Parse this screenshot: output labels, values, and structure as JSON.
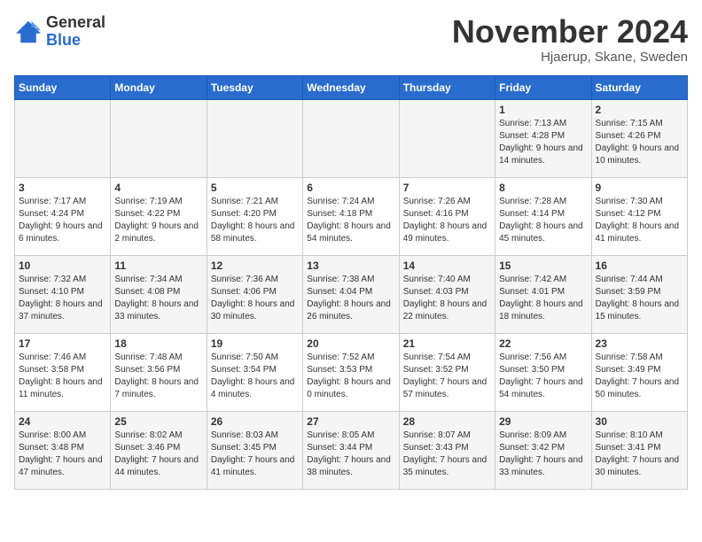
{
  "header": {
    "logo_general": "General",
    "logo_blue": "Blue",
    "month_title": "November 2024",
    "location": "Hjaerup, Skane, Sweden"
  },
  "weekdays": [
    "Sunday",
    "Monday",
    "Tuesday",
    "Wednesday",
    "Thursday",
    "Friday",
    "Saturday"
  ],
  "weeks": [
    [
      {
        "day": "",
        "info": ""
      },
      {
        "day": "",
        "info": ""
      },
      {
        "day": "",
        "info": ""
      },
      {
        "day": "",
        "info": ""
      },
      {
        "day": "",
        "info": ""
      },
      {
        "day": "1",
        "info": "Sunrise: 7:13 AM\nSunset: 4:28 PM\nDaylight: 9 hours and 14 minutes."
      },
      {
        "day": "2",
        "info": "Sunrise: 7:15 AM\nSunset: 4:26 PM\nDaylight: 9 hours and 10 minutes."
      }
    ],
    [
      {
        "day": "3",
        "info": "Sunrise: 7:17 AM\nSunset: 4:24 PM\nDaylight: 9 hours and 6 minutes."
      },
      {
        "day": "4",
        "info": "Sunrise: 7:19 AM\nSunset: 4:22 PM\nDaylight: 9 hours and 2 minutes."
      },
      {
        "day": "5",
        "info": "Sunrise: 7:21 AM\nSunset: 4:20 PM\nDaylight: 8 hours and 58 minutes."
      },
      {
        "day": "6",
        "info": "Sunrise: 7:24 AM\nSunset: 4:18 PM\nDaylight: 8 hours and 54 minutes."
      },
      {
        "day": "7",
        "info": "Sunrise: 7:26 AM\nSunset: 4:16 PM\nDaylight: 8 hours and 49 minutes."
      },
      {
        "day": "8",
        "info": "Sunrise: 7:28 AM\nSunset: 4:14 PM\nDaylight: 8 hours and 45 minutes."
      },
      {
        "day": "9",
        "info": "Sunrise: 7:30 AM\nSunset: 4:12 PM\nDaylight: 8 hours and 41 minutes."
      }
    ],
    [
      {
        "day": "10",
        "info": "Sunrise: 7:32 AM\nSunset: 4:10 PM\nDaylight: 8 hours and 37 minutes."
      },
      {
        "day": "11",
        "info": "Sunrise: 7:34 AM\nSunset: 4:08 PM\nDaylight: 8 hours and 33 minutes."
      },
      {
        "day": "12",
        "info": "Sunrise: 7:36 AM\nSunset: 4:06 PM\nDaylight: 8 hours and 30 minutes."
      },
      {
        "day": "13",
        "info": "Sunrise: 7:38 AM\nSunset: 4:04 PM\nDaylight: 8 hours and 26 minutes."
      },
      {
        "day": "14",
        "info": "Sunrise: 7:40 AM\nSunset: 4:03 PM\nDaylight: 8 hours and 22 minutes."
      },
      {
        "day": "15",
        "info": "Sunrise: 7:42 AM\nSunset: 4:01 PM\nDaylight: 8 hours and 18 minutes."
      },
      {
        "day": "16",
        "info": "Sunrise: 7:44 AM\nSunset: 3:59 PM\nDaylight: 8 hours and 15 minutes."
      }
    ],
    [
      {
        "day": "17",
        "info": "Sunrise: 7:46 AM\nSunset: 3:58 PM\nDaylight: 8 hours and 11 minutes."
      },
      {
        "day": "18",
        "info": "Sunrise: 7:48 AM\nSunset: 3:56 PM\nDaylight: 8 hours and 7 minutes."
      },
      {
        "day": "19",
        "info": "Sunrise: 7:50 AM\nSunset: 3:54 PM\nDaylight: 8 hours and 4 minutes."
      },
      {
        "day": "20",
        "info": "Sunrise: 7:52 AM\nSunset: 3:53 PM\nDaylight: 8 hours and 0 minutes."
      },
      {
        "day": "21",
        "info": "Sunrise: 7:54 AM\nSunset: 3:52 PM\nDaylight: 7 hours and 57 minutes."
      },
      {
        "day": "22",
        "info": "Sunrise: 7:56 AM\nSunset: 3:50 PM\nDaylight: 7 hours and 54 minutes."
      },
      {
        "day": "23",
        "info": "Sunrise: 7:58 AM\nSunset: 3:49 PM\nDaylight: 7 hours and 50 minutes."
      }
    ],
    [
      {
        "day": "24",
        "info": "Sunrise: 8:00 AM\nSunset: 3:48 PM\nDaylight: 7 hours and 47 minutes."
      },
      {
        "day": "25",
        "info": "Sunrise: 8:02 AM\nSunset: 3:46 PM\nDaylight: 7 hours and 44 minutes."
      },
      {
        "day": "26",
        "info": "Sunrise: 8:03 AM\nSunset: 3:45 PM\nDaylight: 7 hours and 41 minutes."
      },
      {
        "day": "27",
        "info": "Sunrise: 8:05 AM\nSunset: 3:44 PM\nDaylight: 7 hours and 38 minutes."
      },
      {
        "day": "28",
        "info": "Sunrise: 8:07 AM\nSunset: 3:43 PM\nDaylight: 7 hours and 35 minutes."
      },
      {
        "day": "29",
        "info": "Sunrise: 8:09 AM\nSunset: 3:42 PM\nDaylight: 7 hours and 33 minutes."
      },
      {
        "day": "30",
        "info": "Sunrise: 8:10 AM\nSunset: 3:41 PM\nDaylight: 7 hours and 30 minutes."
      }
    ]
  ]
}
